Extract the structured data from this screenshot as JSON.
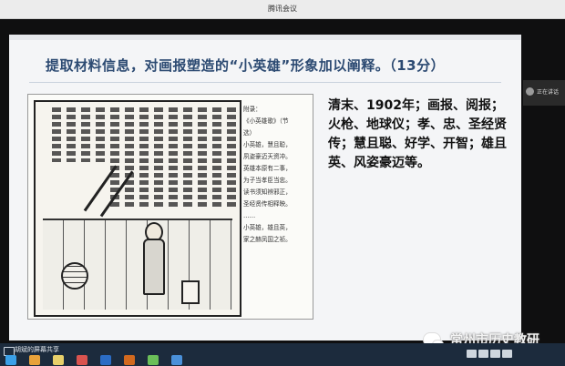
{
  "window": {
    "title": "腾讯会议"
  },
  "slide": {
    "title": "提取材料信息，对画报塑造的“小英雄”形象加以阐释。（13分）",
    "material": {
      "appendix_lines": [
        "附录：",
        "《小英雄歌》（节",
        "选）",
        "小英雄，慧且聪，",
        "夙姿豪迈天资冲。",
        "英雄本原有二事，",
        "为子当孝臣当忠。",
        "读书须知辨邪正，",
        "圣经贤传相释映。",
        "……",
        "小英雄，雄且英，",
        "家之赫凤国之祯。"
      ]
    },
    "answer_text": "清末、1902年；画报、阅报；火枪、地球仪；孝、忠、圣经贤传；慧且聪、好学、开智；雄且英、风姿豪迈等。"
  },
  "participant": {
    "status_text": "正在讲话"
  },
  "share_bar": {
    "label": "胡斌的屏幕共享"
  },
  "watermark": {
    "text": "常州市历史教研"
  },
  "taskbar": {
    "icons": [
      "start-icon",
      "browser-icon",
      "folder-icon",
      "media-icon",
      "word-icon",
      "ppt-icon",
      "app-icon",
      "meeting-icon"
    ]
  },
  "colors": {
    "title": "#2c4a72",
    "share_bar": "#1c2b3d",
    "slide_bg": "#f4f5f7"
  }
}
